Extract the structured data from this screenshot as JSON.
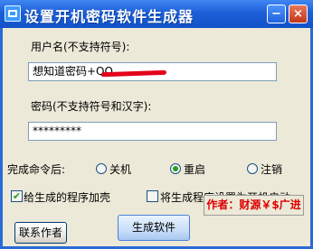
{
  "window": {
    "title": "设置开机密码软件生成器",
    "minimize_label": "−",
    "close_label": "×"
  },
  "username": {
    "label": "用户名(不支持符号):",
    "value": "想知道密码+QQ"
  },
  "password": {
    "label": "密码(不支持符号和汉字):",
    "value": "*********"
  },
  "after_complete": {
    "label": "完成命令后:",
    "options": [
      "关机",
      "重启",
      "注销"
    ],
    "selected": "重启"
  },
  "options": {
    "shell_label": "给生成的程序加壳",
    "shell_checked": true,
    "autostart_label": "将生成程序设置为开机启动",
    "autostart_checked": false
  },
  "buttons": {
    "contact_label": "联系作者",
    "generate_label": "生成软件"
  },
  "author_label": "作者：财源￥$广进",
  "colors": {
    "title_bar": "#1d5fd8",
    "client_bg": "#ece9d8",
    "radio_selected": "#21a121",
    "author_text": "#e00000"
  }
}
